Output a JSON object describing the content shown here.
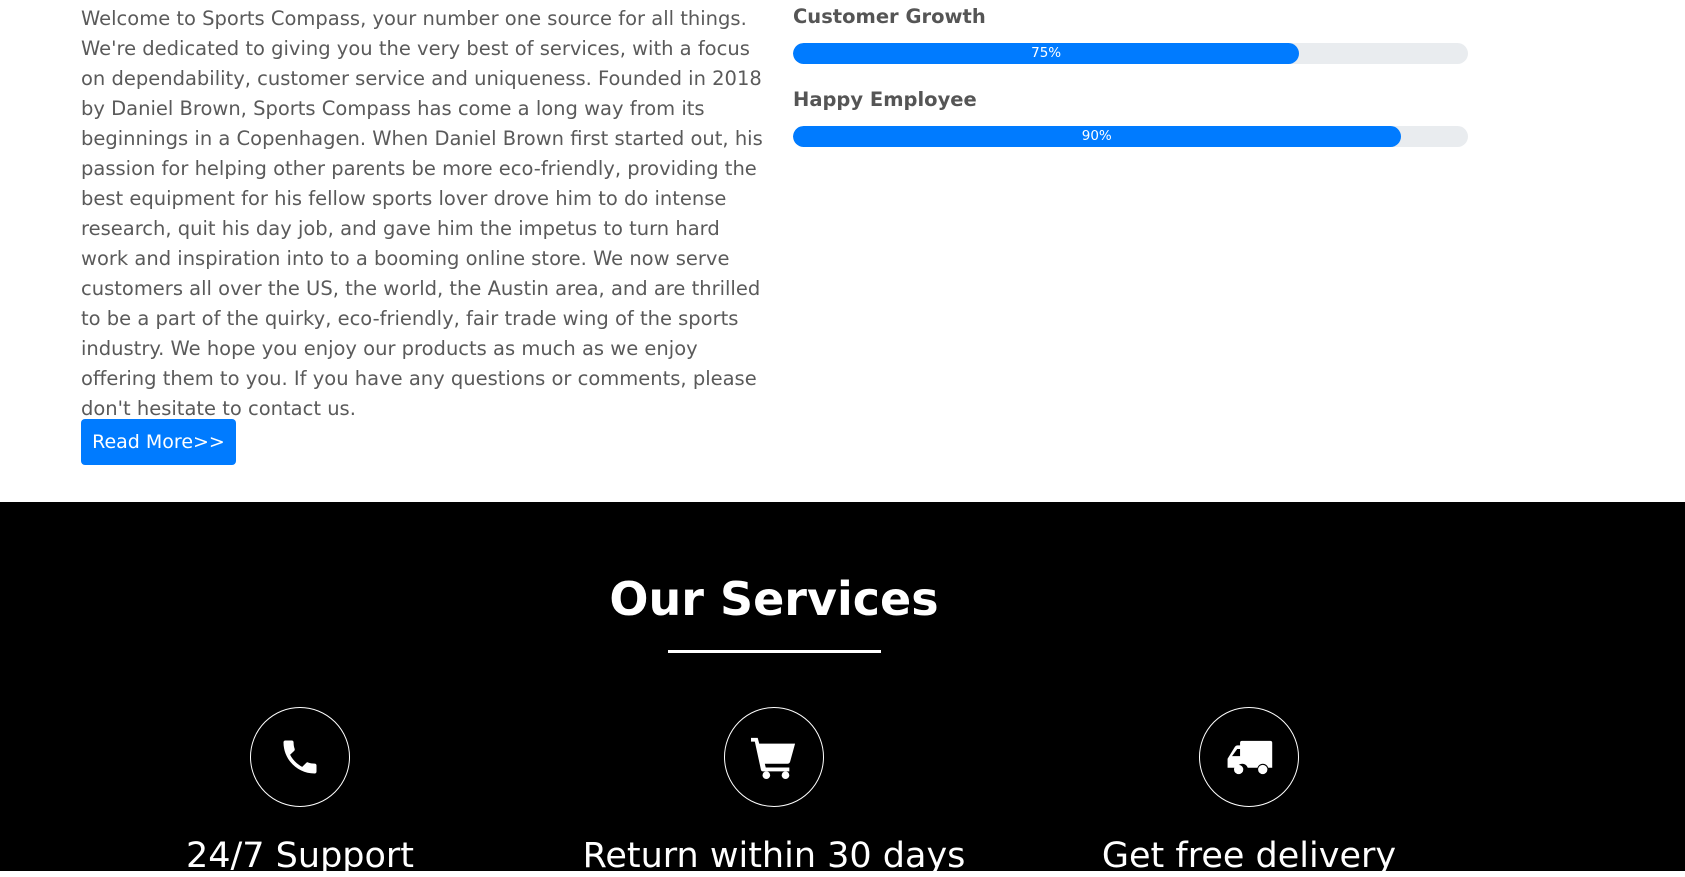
{
  "about": {
    "paragraph": "Welcome to Sports Compass, your number one source for all things. We're dedicated to giving you the very best of services, with a focus on dependability, customer service and uniqueness. Founded in 2018 by Daniel Brown, Sports Compass has come a long way from its beginnings in a Copenhagen. When Daniel Brown first started out, his passion for helping other parents be more eco-friendly, providing the best equipment for his fellow sports lover drove him to do intense research, quit his day job, and gave him the impetus to turn hard work and inspiration into to a booming online store. We now serve customers all over the US, the world, the Austin area, and are thrilled to be a part of the quirky, eco-friendly, fair trade wing of the sports industry. We hope you enjoy our products as much as we enjoy offering them to you. If you have any questions or comments, please don't hesitate to contact us.",
    "read_more_label": "Read More>>"
  },
  "skills": [
    {
      "label": "Customer Growth",
      "percent": 75,
      "percent_text": "75%"
    },
    {
      "label": "Happy Employee",
      "percent": 90,
      "percent_text": "90%"
    }
  ],
  "services": {
    "title": "Our Services",
    "items": [
      {
        "icon": "phone-icon",
        "title": "24/7 Support"
      },
      {
        "icon": "cart-icon",
        "title": "Return within 30 days"
      },
      {
        "icon": "truck-icon",
        "title": "Get free delivery"
      }
    ]
  },
  "colors": {
    "accent": "#007bff",
    "progress_track": "#e9ecef",
    "services_bg": "#000000"
  }
}
